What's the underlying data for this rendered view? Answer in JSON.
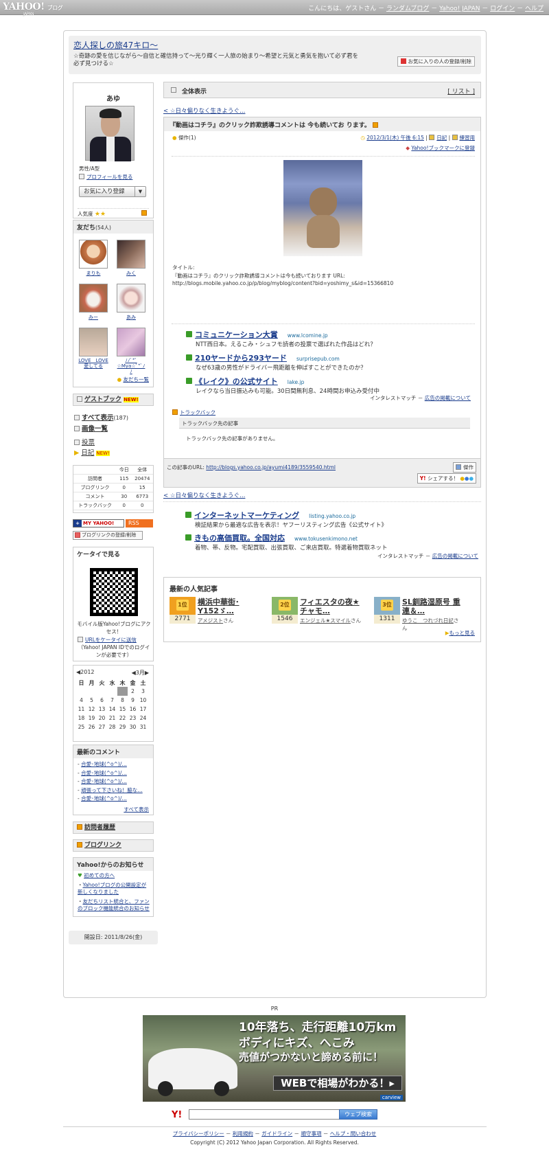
{
  "topbar": {
    "logo": "YAHOO!",
    "logo_sub": "JAPAN",
    "logo_blog": "ブログ",
    "greeting": "こんにちは、ゲストさん",
    "links": [
      "ランダムブログ",
      "Yahoo! JAPAN",
      "ログイン",
      "ヘルプ"
    ]
  },
  "blog": {
    "title": "恋人探しの旅47キロ〜",
    "description": "☆奇跡の愛を信じながら〜自信と確信持って〜光り輝く一人旅の始まり〜希望と元気と勇気を抱いて必ず君を必ず見つける☆",
    "fav_button": "お気に入りの人の登録/削除"
  },
  "profile": {
    "name": "あゆ",
    "info": "男性/A型",
    "profile_link": "プロフィールを見る",
    "fav_register": "お気に入り登録",
    "popularity_label": "人気度"
  },
  "friends": {
    "header": "友だち",
    "count": "(54人)",
    "list": [
      {
        "name": "まりも"
      },
      {
        "name": "みく"
      },
      {
        "name": "みー"
      },
      {
        "name": "あみ"
      },
      {
        "name": "LOVE　LOVE愛してる"
      },
      {
        "name": "ﾉﾉﾞ*ﾟ☆Mya☆ﾟ*ﾞﾉﾉ"
      }
    ],
    "all_link": "友だち一覧"
  },
  "guestbook": {
    "label": "ゲストブック",
    "new": "NEW!"
  },
  "nav": {
    "show_all": "すべて表示",
    "show_all_count": "(187)",
    "images": "画像一覧",
    "cat1": "投票",
    "cat2": "日記",
    "new": "NEW!"
  },
  "stats": {
    "headers": [
      "今日",
      "全体"
    ],
    "rows": [
      {
        "label": "訪問者",
        "today": "115",
        "total": "20474"
      },
      {
        "label": "ブログリンク",
        "today": "0",
        "total": "15"
      },
      {
        "label": "コメント",
        "today": "30",
        "total": "6773"
      },
      {
        "label": "トラックバック",
        "today": "0",
        "total": "0"
      }
    ]
  },
  "badges": {
    "myyahoo": "MY YAHOO!",
    "rss": "RSS",
    "bloglink": "ブログリンクの登録/削除"
  },
  "mobile": {
    "header": "ケータイで見る",
    "text": "モバイル版Yahoo!ブログにアクセス！",
    "send_link": "URLをケータイに送信",
    "note": "（Yahoo! JAPAN IDでのログインが必要です）"
  },
  "calendar": {
    "year": "2012",
    "month": "3月",
    "days": [
      "日",
      "月",
      "火",
      "水",
      "木",
      "金",
      "土"
    ],
    "weeks": [
      [
        "",
        "",
        "",
        "",
        "1",
        "2",
        "3"
      ],
      [
        "4",
        "5",
        "6",
        "7",
        "8",
        "9",
        "10"
      ],
      [
        "11",
        "12",
        "13",
        "14",
        "15",
        "16",
        "17"
      ],
      [
        "18",
        "19",
        "20",
        "21",
        "22",
        "23",
        "24"
      ],
      [
        "25",
        "26",
        "27",
        "28",
        "29",
        "30",
        "31"
      ]
    ]
  },
  "comments": {
    "header": "最新のコメント",
    "items": [
      "合愛･地球(^o^)/…",
      "合愛･地球(^o^)/…",
      "合愛･地球(^o^)/…",
      "頑張って下さいね！脇な…",
      "合愛･地球(^o^)/…"
    ],
    "all": "すべて表示"
  },
  "visitor_history": "訪問者履歴",
  "blog_links": "ブログリンク",
  "notice": {
    "header": "Yahoo!からのお知らせ",
    "beginner": "初めての方へ",
    "items": [
      "Yahoo!ブログの公開設定が新しくなりました",
      "友だちリスト統合と、ファンのブロック機能統合のお知らせ"
    ]
  },
  "opened": "開設日: 2011/8/26(金)",
  "main": {
    "view_all": "全体表示",
    "list_link": "[ リスト ]",
    "prev_link": "< ☆日々偏りなく生きようぐ…",
    "article_title": "『動画はコチラ』のクリック詐欺誘導コメントは 今も続いてお ります。",
    "masterpiece": "傑作(1)",
    "date": "2012/3/1(木) 午後 6:15",
    "cat": "日記",
    "book": "練習用",
    "bookmark": "Yahoo!ブックマークに登録",
    "body_label": "タイトル:",
    "body_text": "『動画はコチラ』のクリック詐欺誘導コメントは今も続いております URL:",
    "body_url": "http://blogs.mobile.yahoo.co.jp/p/blog/myblog/content?bid=yoshimy_s&id=15366810",
    "trackback_label": "トラックバック",
    "trackback_header": "トラックバック先の記事",
    "trackback_none": "トラックバック先の記事がありません。",
    "article_url_label": "この記事のURL:",
    "article_url": "http://blogs.yahoo.co.jp/ayumi4189/3559540.html",
    "masterpiece_btn": "傑作",
    "share": "シェアする！",
    "next_link": "< ☆日々偏りなく生きようぐ…"
  },
  "ads1": [
    {
      "title": "コミュニケーション大賞",
      "url": "www.lcomine.jp",
      "desc": "NTT西日本。えるこみ・シュフモ読者の投票で選ばれた作品はどれ？"
    },
    {
      "title": "210ヤードから293ヤード",
      "url": "surprisepub.com",
      "desc": "なぜ63歳の男性がドライバー飛距離を伸ばすことができたのか？"
    },
    {
      "title": "《レイク》の公式サイト",
      "url": "lake.jp",
      "desc": "レイクなら当日振込みも可能。30日間無利息、24時間お申込み受付中"
    }
  ],
  "ads1_footer": "インタレストマッチ －",
  "ads_link": "広告の掲載について",
  "ads2": [
    {
      "title": "インターネットマーケティング",
      "url": "listing.yahoo.co.jp",
      "desc": "検証結果から最適な広告を表示！ヤフーリスティング広告《公式サイト》"
    },
    {
      "title": "きもの高価買取。全国対応",
      "url": "www.tokusenkimono.net",
      "desc": "着物、帯、反物。宅配買取、出張買取、ご来店買取。特選着物買取ネット"
    }
  ],
  "ads2_footer": "インタレストマッチ －",
  "popular": {
    "header": "最新の人気記事",
    "items": [
      {
        "rank": "1位",
        "count": "2771",
        "title": "横浜中華街･Y152ゞ…",
        "author": "アメジスト",
        "san": "さん"
      },
      {
        "rank": "2位",
        "count": "1546",
        "title": "フィエスタの夜★チャモ…",
        "author": "エンジェル★スマイル",
        "san": "さん"
      },
      {
        "rank": "3位",
        "count": "1311",
        "title": "SL釧路湿原号 重連＆…",
        "author": "ゆうこ　つれづれ日記",
        "san": "さん"
      }
    ],
    "more": "もっと見る"
  },
  "pr": {
    "label": "PR",
    "line1": "10年落ち、走行距離10万km",
    "line2": "ボディにキズ、へこみ",
    "line3": "売値がつかないと諦める前に！",
    "line4": "WEBで相場がわかる！▸",
    "brand": "carview"
  },
  "search": {
    "button": "ウェブ検索",
    "logo": "Y!"
  },
  "footer": {
    "links": [
      "プライバシーポリシー",
      "利用規約",
      "ガイドライン",
      "順守事項",
      "ヘルプ・問い合わせ"
    ],
    "copyright": "Copyright (C) 2012 Yahoo Japan Corporation. All Rights Reserved."
  }
}
